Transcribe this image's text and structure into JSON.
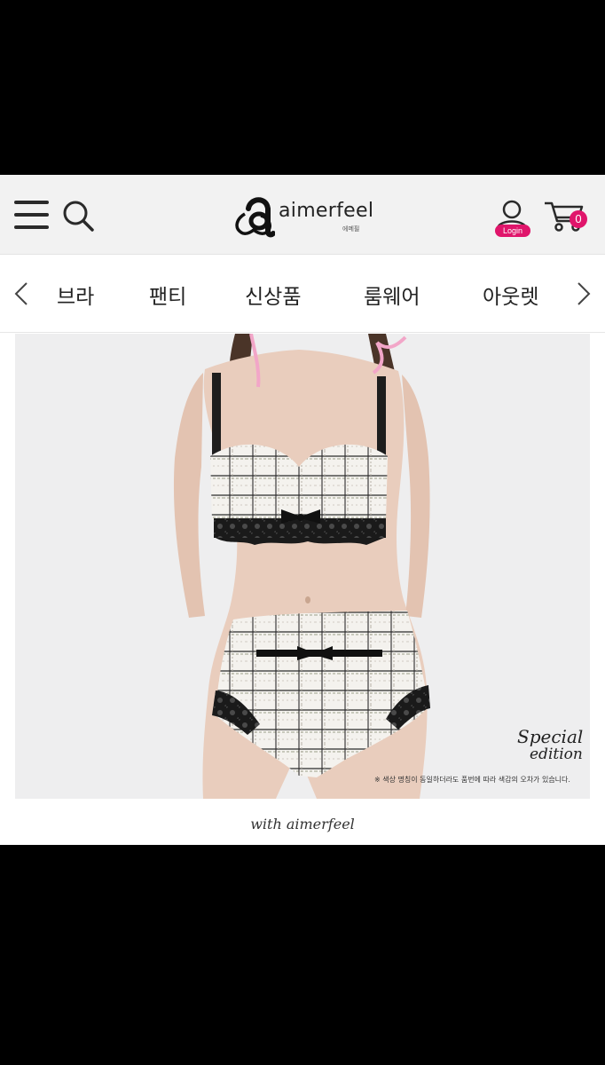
{
  "header": {
    "brand_name": "aimerfeel",
    "brand_sub": "에메필",
    "login_label": "Login",
    "cart_count": "0",
    "accent_color": "#e0156b"
  },
  "nav": {
    "items": [
      {
        "label": "브라"
      },
      {
        "label": "팬티"
      },
      {
        "label": "신상품"
      },
      {
        "label": "룸웨어"
      },
      {
        "label": "아웃렛"
      }
    ]
  },
  "product": {
    "edition_line1": "Special",
    "edition_line2": "edition",
    "disclaimer": "※ 색상 명칭이 동일하더라도 품번에 따라 색감의 오차가 있습니다."
  },
  "footer_caption": "with aimerfeel",
  "icons": [
    "menu-icon",
    "search-icon",
    "user-icon",
    "cart-icon",
    "chevron-left-icon",
    "chevron-right-icon"
  ]
}
